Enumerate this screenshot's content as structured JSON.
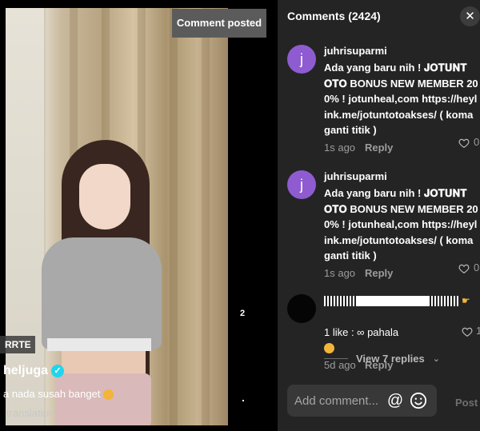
{
  "video": {
    "toast": "Comment posted",
    "strip_label": "RRTE",
    "username": "heljuga",
    "caption": "a nada susah banget",
    "translation_label": "translation",
    "side_count": "2"
  },
  "panel": {
    "title": "Comments (2424)",
    "close_icon": "close-icon"
  },
  "comments": [
    {
      "avatar_letter": "j",
      "username": "juhrisuparmi",
      "text": "Ada yang baru nih ! 𝐉𝐎𝐓𝐔𝐍𝐓𝐎𝐓𝐎 BONUS NEW MEMBER 200% ! jotunheal,com https://heylink.me/jotuntotoakses/ ( koma ganti titik )",
      "time": "1s ago",
      "reply_label": "Reply",
      "likes": "0"
    },
    {
      "avatar_letter": "j",
      "username": "juhrisuparmi",
      "text": "Ada yang baru nih ! 𝐉𝐎𝐓𝐔𝐍𝐓𝐎𝐓𝐎 BONUS NEW MEMBER 200% ! jotunheal,com https://heylink.me/jotuntotoakses/ ( koma ganti titik )",
      "time": "1s ago",
      "reply_label": "Reply",
      "likes": "0"
    },
    {
      "avatar_letter": "",
      "username": "",
      "text": "1 like : ∞ pahala",
      "time": "5d ago",
      "reply_label": "Reply",
      "likes": "1"
    }
  ],
  "view_replies_label": "View 7 replies",
  "input": {
    "placeholder": "Add comment...",
    "at_icon": "at-icon",
    "emoji_icon": "smile-icon",
    "post_label": "Post"
  },
  "colors": {
    "avatar_purple": "#8e5bd0",
    "panel_bg": "#242424",
    "muted_text": "#9c9c9c",
    "verified_blue": "#20d5ec"
  }
}
